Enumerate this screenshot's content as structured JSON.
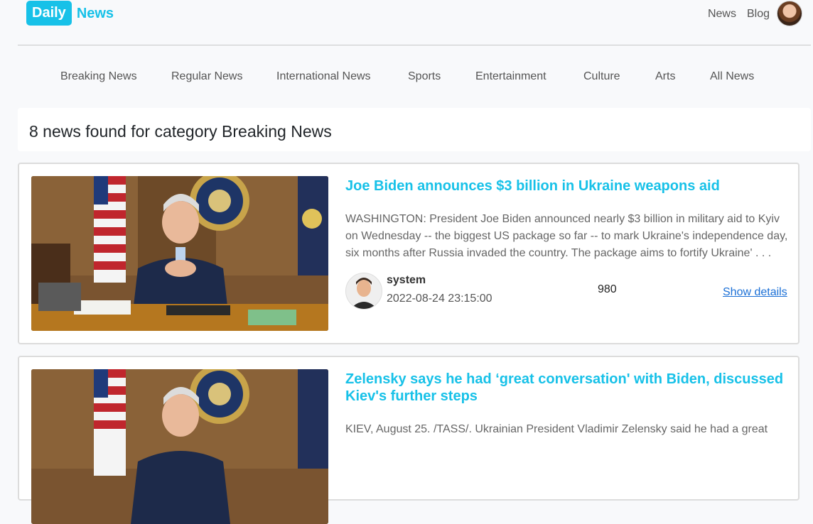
{
  "brand": {
    "box": "Daily",
    "text": "News"
  },
  "top_nav": [
    "News",
    "Blog"
  ],
  "categories": [
    "Breaking News",
    "Regular News",
    "International News",
    "Sports",
    "Entertainment",
    "Culture",
    "Arts",
    "All News"
  ],
  "result_heading": "8 news found for category Breaking News",
  "articles": [
    {
      "title": "Joe Biden announces $3 billion in Ukraine weapons aid",
      "summary": "WASHINGTON: President Joe Biden announced nearly $3 billion in military aid to Kyiv on Wednesday -- the biggest US package so far -- to mark Ukraine's independence day, six months after Russia invaded the country. The package aims to fortify Ukraine' . . .",
      "author": "system",
      "date": "2022-08-24 23:15:00",
      "views": "980",
      "details_label": "Show details"
    },
    {
      "title": "Zelensky says he had ‘great conversation' with Biden, discussed Kiev's further steps",
      "summary": "KIEV, August 25. /TASS/. Ukrainian President Vladimir Zelensky said he had a great"
    }
  ]
}
